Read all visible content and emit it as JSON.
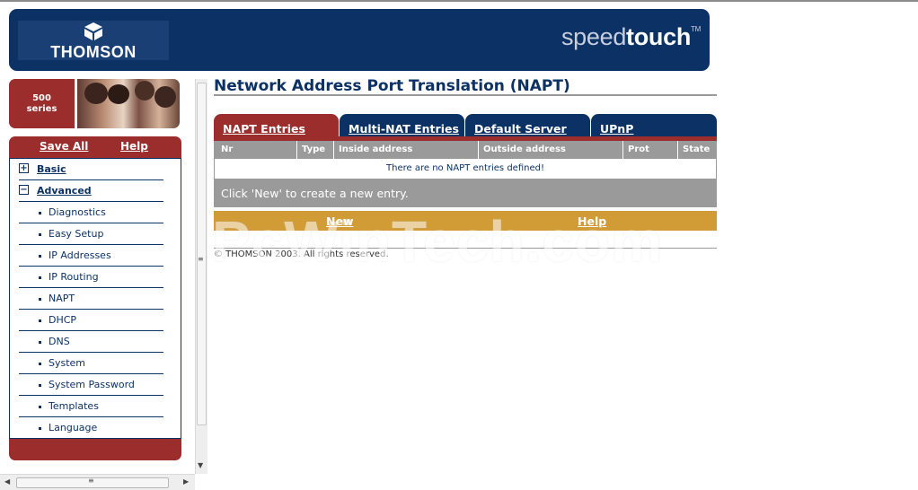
{
  "header": {
    "logo_text": "THOMSON",
    "brand_light": "speed",
    "brand_bold": "touch",
    "brand_tm": "TM"
  },
  "badge": {
    "line1": "500",
    "line2": "series"
  },
  "sidebar": {
    "save_all_label": "Save All",
    "help_label": "Help",
    "sections": [
      {
        "label": "Basic",
        "expanded": false,
        "toggle_glyph": "+"
      },
      {
        "label": "Advanced",
        "expanded": true,
        "toggle_glyph": "−"
      }
    ],
    "advanced_items": [
      "Diagnostics",
      "Easy Setup",
      "IP Addresses",
      "IP Routing",
      "NAPT",
      "DHCP",
      "DNS",
      "System",
      "System Password",
      "Templates",
      "Language"
    ]
  },
  "main": {
    "page_title": "Network Address Port Translation (NAPT)",
    "tabs": [
      {
        "label": "NAPT Entries",
        "active": true
      },
      {
        "label": "Multi-NAT Entries",
        "active": false
      },
      {
        "label": "Default Server",
        "active": false
      },
      {
        "label": "UPnP",
        "active": false
      }
    ],
    "table": {
      "columns": [
        "Nr",
        "Type",
        "Inside address",
        "Outside address",
        "Prot",
        "State"
      ],
      "empty_message": "There are no NAPT entries defined!"
    },
    "hint": "Click 'New' to create a new entry.",
    "actions": {
      "new_label": "New",
      "help_label": "Help"
    },
    "copyright": "© THOMSON 2003. All rights reserved.",
    "watermark": "PcWinTech.com"
  },
  "scrollbars": {
    "grip_glyph": "≡",
    "up_glyph": "▲",
    "down_glyph": "▼",
    "left_glyph": "◀",
    "right_glyph": "▶"
  },
  "colors": {
    "navy": "#0c3265",
    "maroon": "#9b2d2d",
    "gray": "#9a9a9a",
    "gold": "#d19c36"
  }
}
